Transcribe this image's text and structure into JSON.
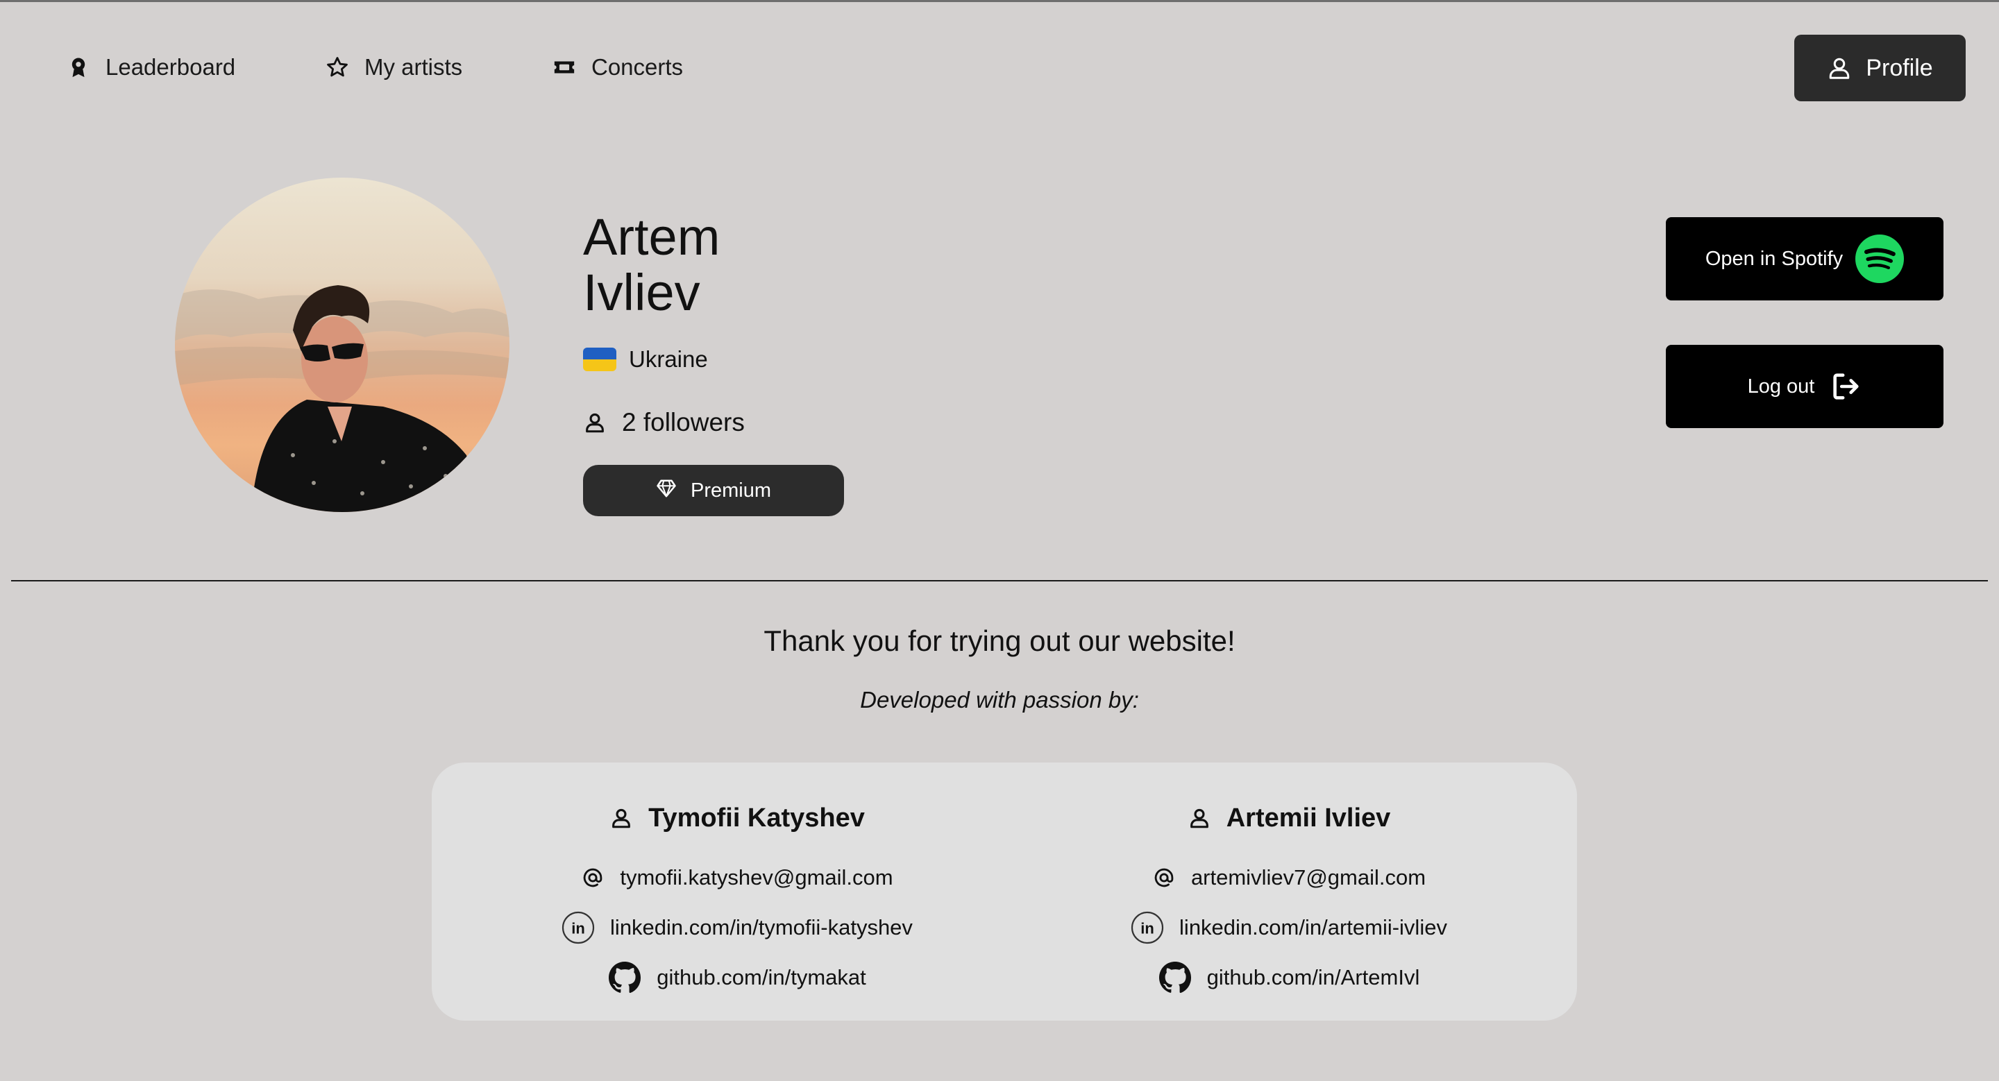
{
  "nav": {
    "leaderboard": "Leaderboard",
    "my_artists": "My artists",
    "concerts": "Concerts",
    "profile": "Profile"
  },
  "profile": {
    "first_name": "Artem",
    "last_name": "Ivliev",
    "country": "Ukraine",
    "followers": "2 followers",
    "badge": "Premium",
    "open_spotify": "Open in Spotify",
    "logout": "Log out"
  },
  "footer": {
    "thanks": "Thank you for trying out our website!",
    "developed_by": "Developed with passion by:",
    "developers": [
      {
        "name": "Tymofii Katyshev",
        "email": "tymofii.katyshev@gmail.com",
        "linkedin": "linkedin.com/in/tymofii-katyshev",
        "github": "github.com/in/tymakat"
      },
      {
        "name": "Artemii Ivliev",
        "email": "artemivliev7@gmail.com",
        "linkedin": "linkedin.com/in/artemii-ivliev",
        "github": "github.com/in/ArtemIvl"
      }
    ]
  },
  "colors": {
    "background": "#d4d1d0",
    "dark_button": "#2b2b2b",
    "black_button": "#000000",
    "spotify_green": "#1ed760",
    "card": "#e0e0e0"
  }
}
